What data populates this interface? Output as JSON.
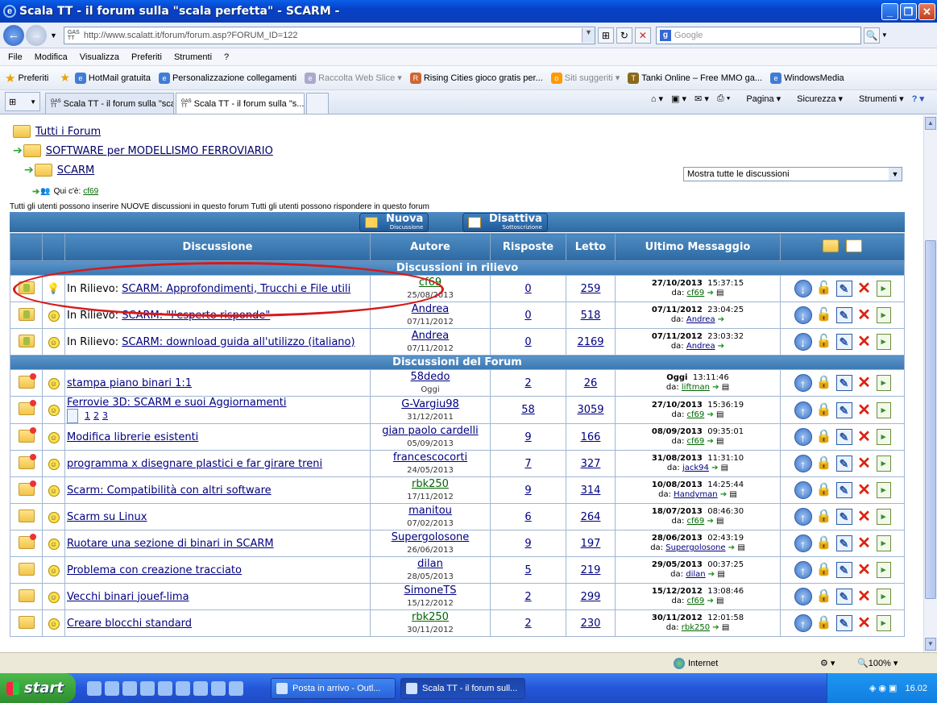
{
  "window": {
    "title": "Scala TT - il forum sulla \"scala perfetta\" - SCARM -"
  },
  "address": {
    "url": "http://www.scalatt.it/forum/forum.asp?FORUM_ID=122",
    "search_placeholder": "Google"
  },
  "menu": [
    "File",
    "Modifica",
    "Visualizza",
    "Preferiti",
    "Strumenti",
    "?"
  ],
  "favorites": {
    "label": "Preferiti",
    "items": [
      "HotMail gratuita",
      "Personalizzazione collegamenti",
      "Raccolta Web Slice",
      "Rising Cities gioco gratis per...",
      "Siti suggeriti",
      "Tanki Online – Free MMO ga...",
      "WindowsMedia"
    ]
  },
  "tabs": [
    {
      "label": "Scala TT - il forum sulla \"scala...",
      "active": false
    },
    {
      "label": "Scala TT - il forum sulla \"s...",
      "active": true
    }
  ],
  "commands": [
    "Pagina",
    "Sicurezza",
    "Strumenti"
  ],
  "breadcrumb": [
    "Tutti i Forum",
    "SOFTWARE per MODELLISMO FERROVIARIO",
    "SCARM"
  ],
  "filter": {
    "selected": "Mostra tutte le discussioni"
  },
  "online": {
    "label": "Qui c'è:",
    "user": "cf69"
  },
  "permissions": "Tutti gli utenti possono inserire NUOVE discussioni in questo forum Tutti gli utenti possono rispondere in questo forum",
  "buttons": {
    "new": {
      "title": "Nuova",
      "sub": "Discussione"
    },
    "unsub": {
      "title": "Disattiva",
      "sub": "Sottoscrizione"
    }
  },
  "columns": {
    "topic": "Discussione",
    "author": "Autore",
    "replies": "Risposte",
    "views": "Letto",
    "last": "Ultimo Messaggio"
  },
  "sections": {
    "featured": "Discussioni in rilievo",
    "forum": "Discussioni del Forum"
  },
  "featured": [
    {
      "prefix": "In Rilievo:",
      "title": "SCARM: Approfondimenti, Trucchi e File utili",
      "author": "cf69",
      "author_green": true,
      "date": "25/08/2013",
      "replies": "0",
      "views": "259",
      "last_date": "27/10/2013",
      "last_time": "15:37:15",
      "last_by_label": "da:",
      "last_by": "cf69",
      "last_by_green": true
    },
    {
      "prefix": "In Rilievo:",
      "title": "SCARM: \"l'esperto risponde\"",
      "author": "Andrea",
      "author_green": false,
      "date": "07/11/2012",
      "replies": "0",
      "views": "518",
      "last_date": "07/11/2012",
      "last_time": "23:04:25",
      "last_by_label": "da:",
      "last_by": "Andrea",
      "last_by_green": false
    },
    {
      "prefix": "In Rilievo:",
      "title": "SCARM: download guida all'utilizzo (italiano)",
      "author": "Andrea",
      "author_green": false,
      "date": "07/11/2012",
      "replies": "0",
      "views": "2169",
      "last_date": "07/11/2012",
      "last_time": "23:03:32",
      "last_by_label": "da:",
      "last_by": "Andrea",
      "last_by_green": false
    }
  ],
  "topics": [
    {
      "title": "stampa piano binari 1:1",
      "author": "58dedo",
      "author_green": false,
      "date": "Oggi",
      "replies": "2",
      "views": "26",
      "last_date": "Oggi",
      "last_time": "13:11:46",
      "last_by_label": "da:",
      "last_by": "liftman",
      "last_by_green": true,
      "folder": "new"
    },
    {
      "title": "Ferrovie 3D: SCARM e suoi Aggiornamenti",
      "pages": [
        "1",
        "2",
        "3"
      ],
      "author": "G-Vargiu98",
      "author_green": false,
      "date": "31/12/2011",
      "replies": "58",
      "views": "3059",
      "last_date": "27/10/2013",
      "last_time": "15:36:19",
      "last_by_label": "da:",
      "last_by": "cf69",
      "last_by_green": true,
      "folder": "hot"
    },
    {
      "title": "Modifica librerie esistenti",
      "author": "gian paolo cardelli",
      "author_green": false,
      "date": "05/09/2013",
      "replies": "9",
      "views": "166",
      "last_date": "08/09/2013",
      "last_time": "09:35:01",
      "last_by_label": "da:",
      "last_by": "cf69",
      "last_by_green": true,
      "folder": "hot"
    },
    {
      "title": "programma x disegnare plastici e far girare treni",
      "author": "francescocorti",
      "author_green": false,
      "date": "24/05/2013",
      "replies": "7",
      "views": "327",
      "last_date": "31/08/2013",
      "last_time": "11:31:10",
      "last_by_label": "da:",
      "last_by": "jack94",
      "last_by_green": false,
      "folder": "hot"
    },
    {
      "title": "Scarm: Compatibilità con altri software",
      "author": "rbk250",
      "author_green": true,
      "date": "17/11/2012",
      "replies": "9",
      "views": "314",
      "last_date": "10/08/2013",
      "last_time": "14:25:44",
      "last_by_label": "da:",
      "last_by": "Handyman",
      "last_by_green": false,
      "folder": "hot"
    },
    {
      "title": "Scarm su Linux",
      "author": "manitou",
      "author_green": false,
      "date": "07/02/2013",
      "replies": "6",
      "views": "264",
      "last_date": "18/07/2013",
      "last_time": "08:46:30",
      "last_by_label": "da:",
      "last_by": "cf69",
      "last_by_green": true,
      "folder": "plain"
    },
    {
      "title": "Ruotare una sezione di binari in SCARM",
      "author": "Supergolosone",
      "author_green": false,
      "date": "26/06/2013",
      "replies": "9",
      "views": "197",
      "last_date": "28/06/2013",
      "last_time": "02:43:19",
      "last_by_label": "da:",
      "last_by": "Supergolosone",
      "last_by_green": false,
      "folder": "hot"
    },
    {
      "title": "Problema con creazione tracciato",
      "author": "dilan",
      "author_green": false,
      "date": "28/05/2013",
      "replies": "5",
      "views": "219",
      "last_date": "29/05/2013",
      "last_time": "00:37:25",
      "last_by_label": "da:",
      "last_by": "dilan",
      "last_by_green": false,
      "folder": "plain"
    },
    {
      "title": "Vecchi binari jouef-lima",
      "author": "SimoneTS",
      "author_green": false,
      "date": "15/12/2012",
      "replies": "2",
      "views": "299",
      "last_date": "15/12/2012",
      "last_time": "13:08:46",
      "last_by_label": "da:",
      "last_by": "cf69",
      "last_by_green": true,
      "folder": "plain"
    },
    {
      "title": "Creare blocchi standard",
      "author": "rbk250",
      "author_green": true,
      "date": "30/11/2012",
      "replies": "2",
      "views": "230",
      "last_date": "30/11/2012",
      "last_time": "12:01:58",
      "last_by_label": "da:",
      "last_by": "rbk250",
      "last_by_green": true,
      "folder": "plain"
    }
  ],
  "status": {
    "zone": "Internet",
    "zoom": "100%"
  },
  "taskbar": {
    "start": "start",
    "tasks": [
      "Posta in arrivo - Outl...",
      "Scala TT - il forum sull..."
    ],
    "clock": "16.02"
  },
  "colors": {
    "header_blue": "#2d6aa3",
    "link": "#000080",
    "user_green": "#006600",
    "highlight_red": "#d61a1a"
  }
}
